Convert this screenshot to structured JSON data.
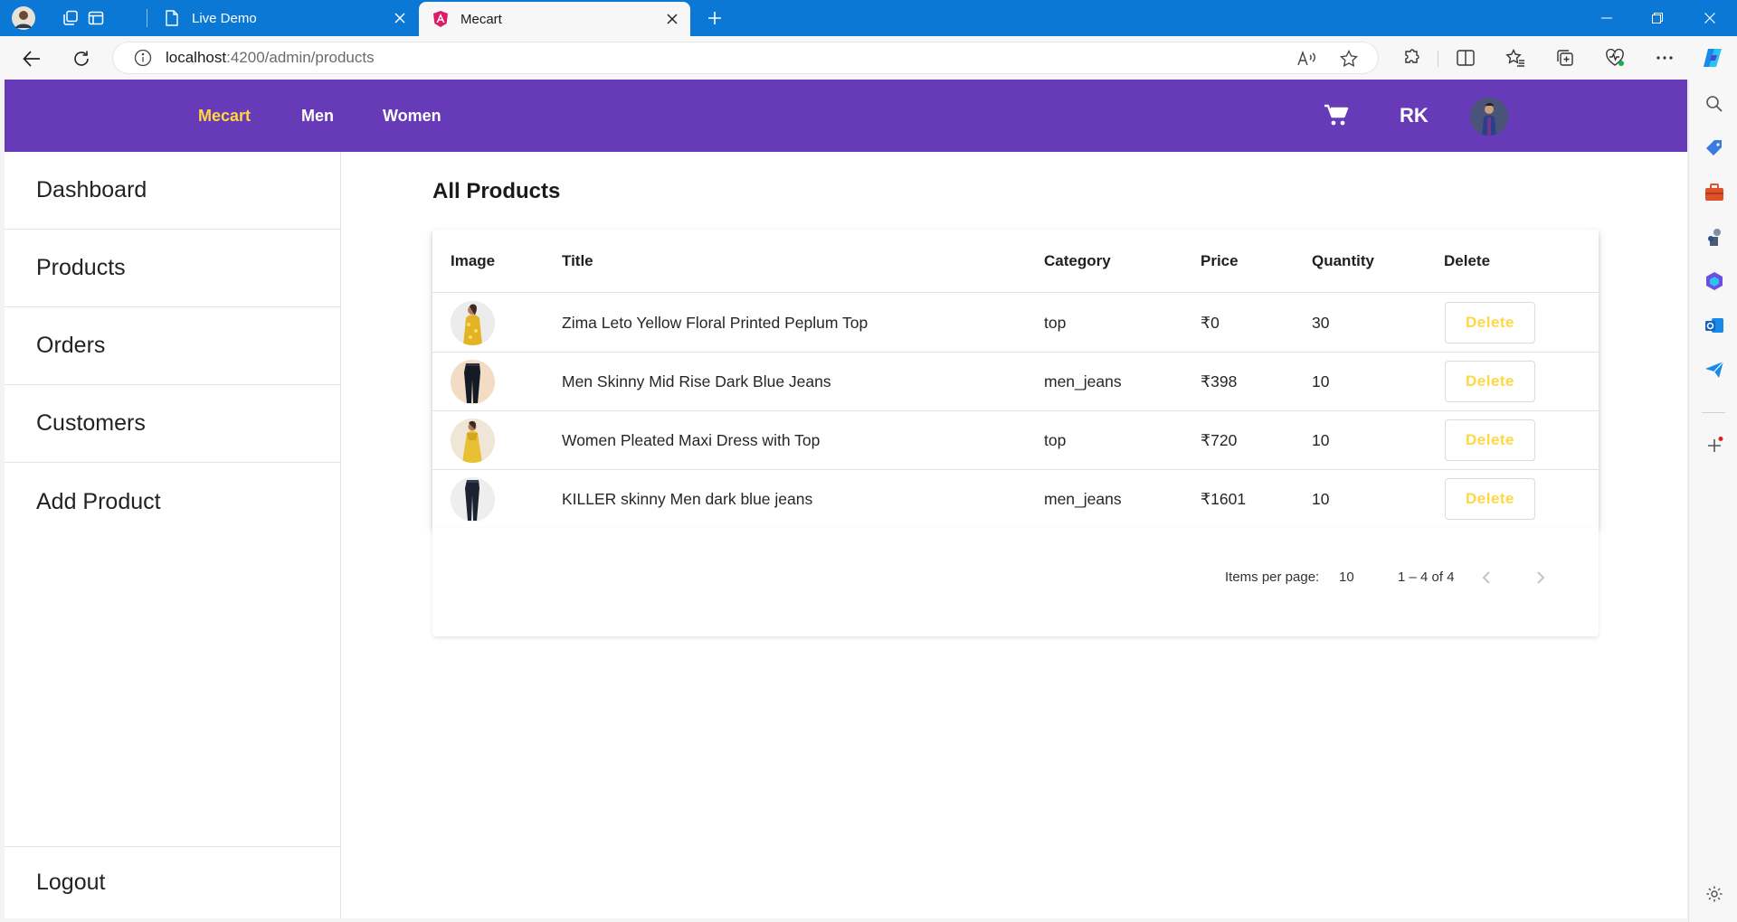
{
  "browser": {
    "tabs": [
      {
        "title": "Live Demo",
        "active": false
      },
      {
        "title": "Mecart",
        "active": true
      }
    ],
    "url_host": "localhost",
    "url_path": ":4200/admin/products"
  },
  "app": {
    "brand": "Mecart",
    "nav": [
      "Men",
      "Women"
    ],
    "user_initials": "RK",
    "colors": {
      "primary": "#673ab7",
      "accent": "#ffd740"
    }
  },
  "sidebar": {
    "items": [
      "Dashboard",
      "Products",
      "Orders",
      "Customers",
      "Add Product"
    ],
    "logout": "Logout"
  },
  "main": {
    "heading": "All Products",
    "columns": [
      "Image",
      "Title",
      "Category",
      "Price",
      "Quantity",
      "Delete"
    ],
    "rows": [
      {
        "title": "Zima Leto Yellow Floral Printed Peplum Top",
        "category": "top",
        "price": "₹0",
        "quantity": "30",
        "action": "Delete"
      },
      {
        "title": "Men Skinny Mid Rise Dark Blue Jeans",
        "category": "men_jeans",
        "price": "₹398",
        "quantity": "10",
        "action": "Delete"
      },
      {
        "title": "Women Pleated Maxi Dress with Top",
        "category": "top",
        "price": "₹720",
        "quantity": "10",
        "action": "Delete"
      },
      {
        "title": "KILLER skinny Men dark blue jeans",
        "category": "men_jeans",
        "price": "₹1601",
        "quantity": "10",
        "action": "Delete"
      }
    ],
    "paginator": {
      "items_per_page_label": "Items per page:",
      "items_per_page": "10",
      "range": "1 – 4 of 4"
    }
  }
}
